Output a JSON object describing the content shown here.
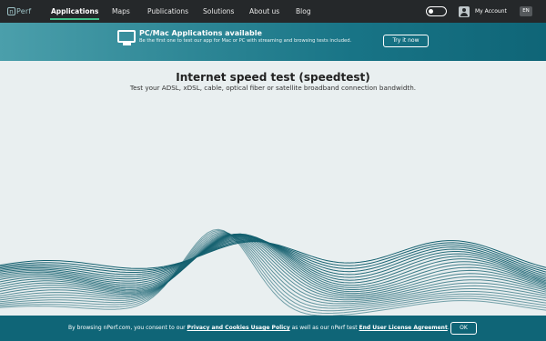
{
  "nav": {
    "logo_mark": "n",
    "logo_text": "Perf",
    "links": [
      "Applications",
      "Maps",
      "Publications",
      "Solutions",
      "About us",
      "Blog"
    ],
    "active": "Applications",
    "account_label": "My Account",
    "language": "EN"
  },
  "banner": {
    "title": "PC/Mac Applications available",
    "subtitle": "Be the first one to test our app for Mac or PC with streaming and browsing tests included.",
    "button_label": "Try it now"
  },
  "main": {
    "title": "Internet speed test (speedtest)",
    "subtitle": "Test your ADSL, xDSL, cable, optical fiber or satellite broadband connection bandwidth."
  },
  "cookie": {
    "text_before": "By browsing nPerf.com, you consent to our ",
    "link1": "Privacy and Cookies Usage Policy",
    "text_middle": " as well as our nPerf test ",
    "link2": "End User License Agreement",
    "text_after": ".",
    "ok_label": "OK"
  },
  "colors": {
    "nav_bg": "#25282a",
    "accent_green": "#3fbf8a",
    "teal": "#0f6577",
    "page_bg": "#e9eff0",
    "wave": "#14606f"
  },
  "icons": [
    "monitor-icon",
    "user-icon",
    "toggle-switch"
  ]
}
